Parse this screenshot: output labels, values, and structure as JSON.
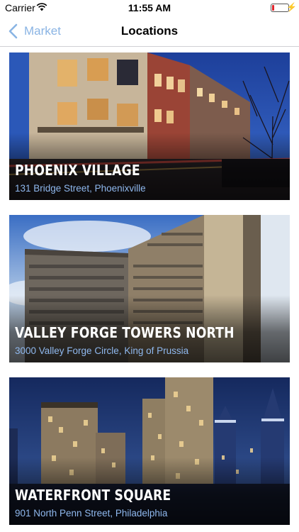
{
  "status_bar": {
    "carrier": "Carrier",
    "time": "11:55 AM",
    "battery_level": 0.15,
    "battery_color": "#e0242b",
    "icons": [
      "wifi-icon",
      "battery-icon",
      "charging-bolt-icon"
    ]
  },
  "nav": {
    "back_label": "Market",
    "title": "Locations",
    "accent": "#8ab4e4"
  },
  "locations": [
    {
      "name": "PHOENIX VILLAGE",
      "address": "131 Bridge Street, Phoenixville"
    },
    {
      "name": "VALLEY FORGE TOWERS NORTH",
      "address": "3000 Valley Forge Circle, King of Prussia"
    },
    {
      "name": "WATERFRONT SQUARE",
      "address": "901 North Penn Street, Philadelphia"
    }
  ]
}
